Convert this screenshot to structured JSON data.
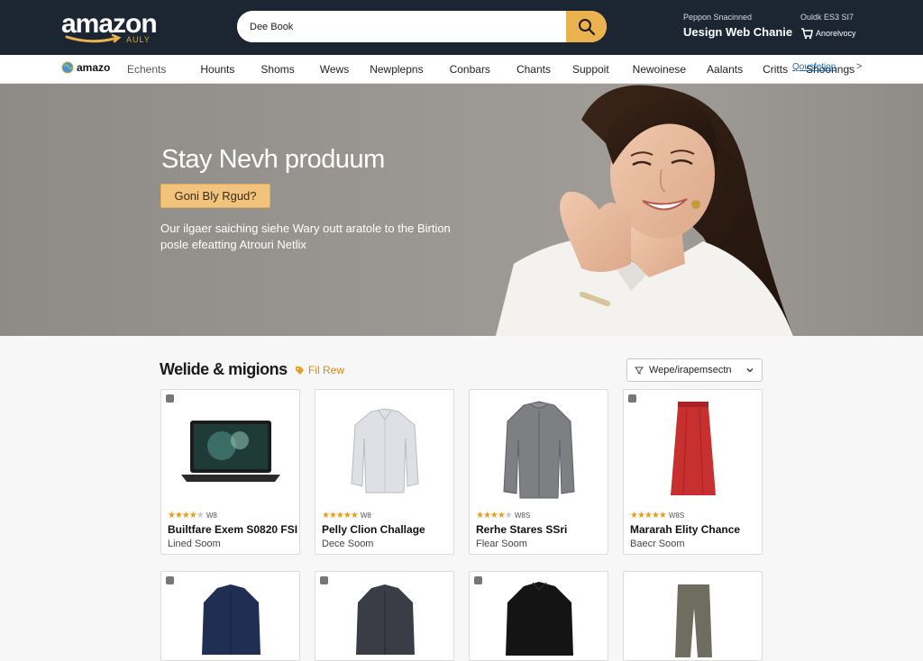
{
  "header": {
    "logo_word": "amazon",
    "logo_sub": "AULY",
    "search_value": "Dee Book",
    "account_small": "Peppon Snacinned",
    "account_big": "Uesign Web Chanie",
    "orders_small": "Ouldk ES3 SI7",
    "orders_label": "Anorelvocy"
  },
  "nav": {
    "logo": "amazo",
    "items": [
      "Echents",
      "Hounts",
      "Shoms",
      "Wews",
      "Newplepns",
      "Conbars",
      "Chants",
      "Suppoit",
      "Newoinese",
      "Aalants",
      "Critts",
      "Shoonngs"
    ],
    "link": "Qousfetion",
    "more": "→ >"
  },
  "hero": {
    "title": "Stay Nevh produum",
    "button": "Goni Bly Rgud?",
    "desc_line1": "Our ilgaer saiching siehe Wary outt aratole to the Birtion",
    "desc_line2": "posle efeatting Atrouri Netlix"
  },
  "section": {
    "title": "Welide & migions",
    "arrow": "›",
    "link": "Fil Rew",
    "sort": "Wepe/irapemsectn"
  },
  "products": [
    {
      "name": "Builtfare Exem S0820 FSI",
      "price": "Lined Soom",
      "rating": 3.5,
      "count": "W8",
      "image": "laptop"
    },
    {
      "name": "Pelly Clion Challage",
      "price": "Dece Soom",
      "rating": 5,
      "count": "W8",
      "image": "white-shirt"
    },
    {
      "name": "Rerhe Stares SSri",
      "price": "Flear Soom",
      "rating": 4.5,
      "count": "W8S",
      "image": "gray-cardigan"
    },
    {
      "name": "Mararah Elity Chance",
      "price": "Baecr Soom",
      "rating": 5,
      "count": "W8S",
      "image": "red-skirt"
    }
  ],
  "products_row2": [
    {
      "image": "navy-shirt"
    },
    {
      "image": "charcoal-shirt"
    },
    {
      "image": "black-jacket"
    },
    {
      "image": "olive-pants"
    }
  ],
  "colors": {
    "topbar": "#1c2633",
    "accent": "#e9b24f",
    "star": "#e39e1c",
    "link": "#1f6aa5"
  }
}
